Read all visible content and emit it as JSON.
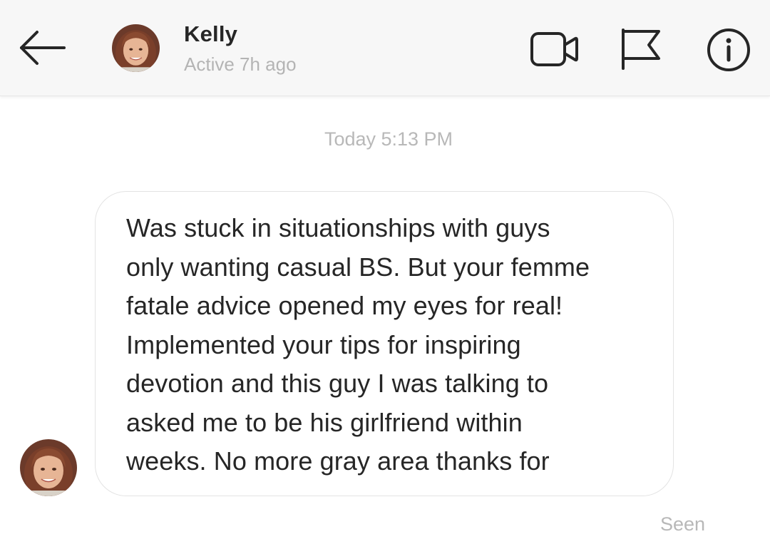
{
  "header": {
    "contact_name": "Kelly",
    "contact_status": "Active 7h ago",
    "icons": {
      "back": "back-arrow-icon",
      "video": "video-camera-icon",
      "flag": "flag-icon",
      "info": "info-icon"
    }
  },
  "conversation": {
    "timestamp": "Today 5:13 PM",
    "messages": [
      {
        "sender": "Kelly",
        "text": "Was stuck in situationships with guys\nonly wanting casual BS. But your femme\nfatale advice opened my eyes for real!\nImplemented your tips for inspiring\ndevotion and this guy I was talking to\nasked me to be his girlfriend within\nweeks. No more gray area thanks for"
      }
    ],
    "read_receipt": "Seen"
  },
  "colors": {
    "header_background": "#f7f7f7",
    "primary_text": "#262626",
    "secondary_text": "#b4b4b4",
    "bubble_border": "#e3e3e3"
  }
}
